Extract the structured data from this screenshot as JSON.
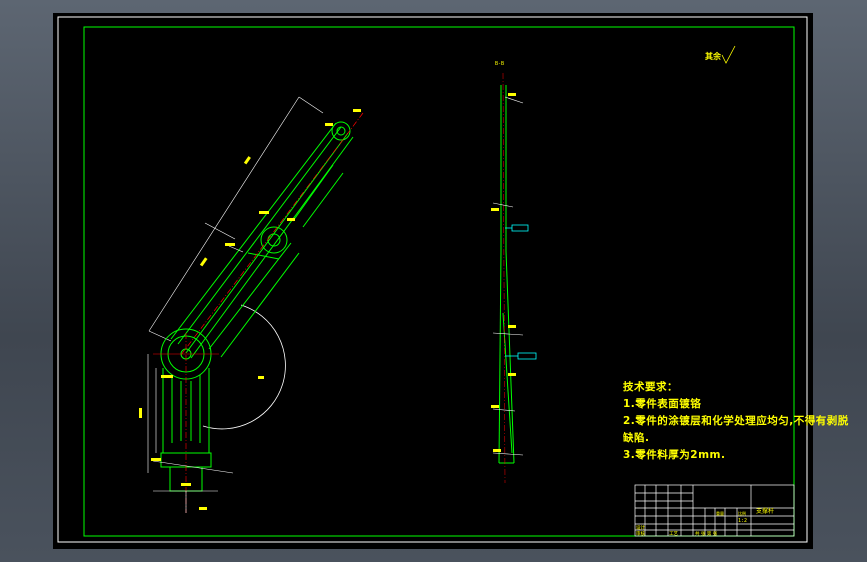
{
  "drawing": {
    "background": "#000000",
    "frame_color": "#00ff00",
    "part_color": "#00ff00",
    "dimension_color": "#ffff00",
    "centerline_color": "#ff0000",
    "callout_color": "#00ffff"
  },
  "roughness_note": "其余",
  "section_label": "B-B",
  "technical_requirements": {
    "title": "技术要求：",
    "items": [
      "1.零件表面镀铬",
      "2.零件的涂镀层和化学处理应均匀,不得有剥脱",
      "缺陷.",
      "3.零件料厚为2mm."
    ]
  },
  "title_block": {
    "part_name": "支撑杆",
    "scale": "1:2",
    "label_designer": "设计",
    "label_review": "审核",
    "label_process": "工艺",
    "label_weight": "重量",
    "label_scale": "比例",
    "label_sheet": "共 张  第 张"
  }
}
